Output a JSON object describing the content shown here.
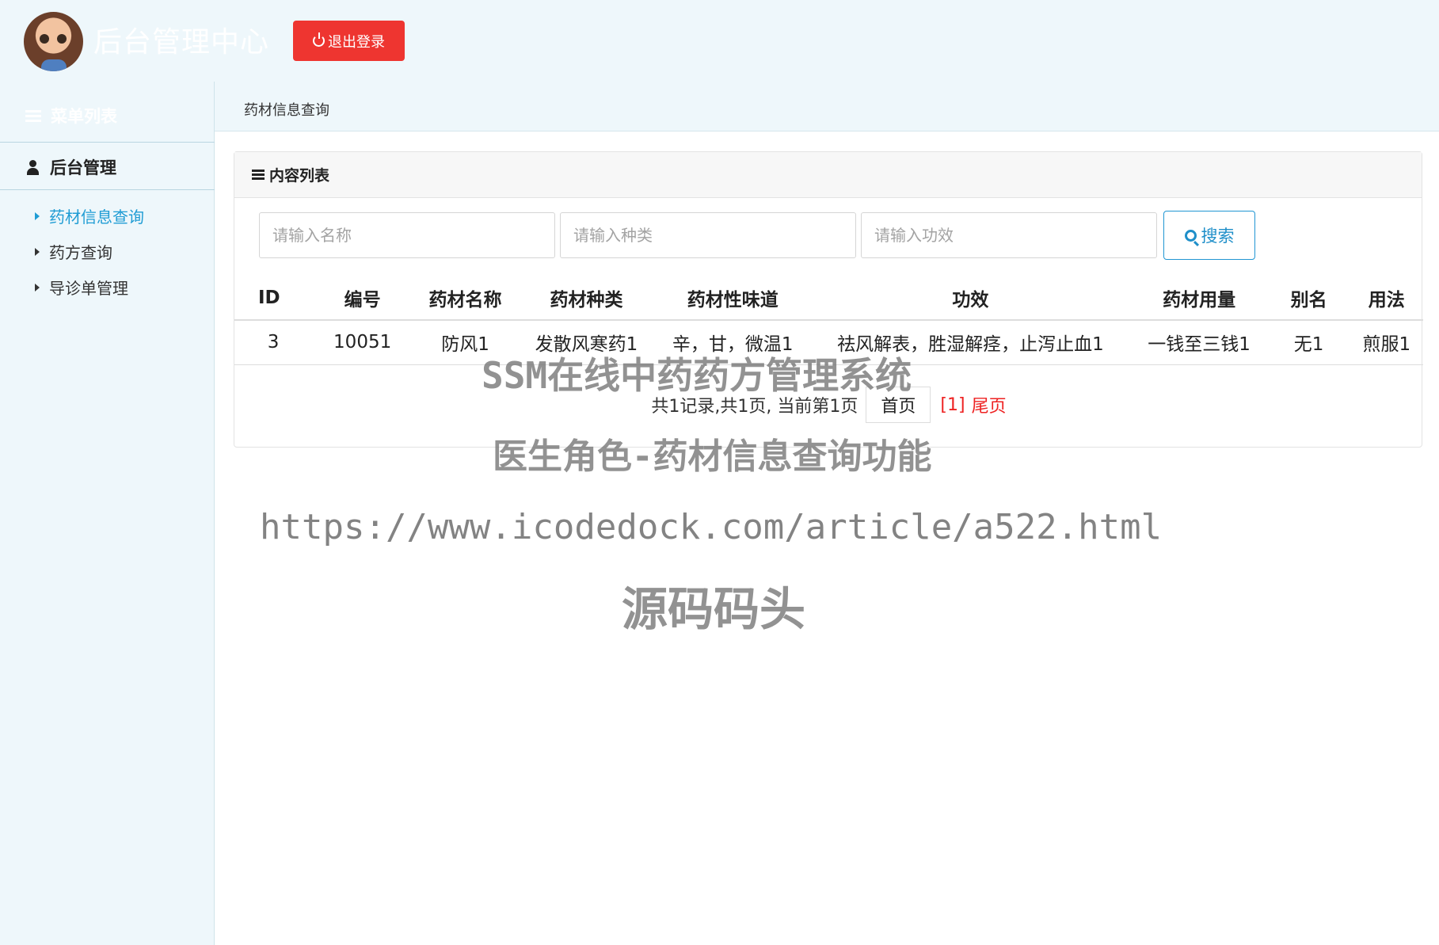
{
  "header": {
    "title": "后台管理中心",
    "logout_label": "退出登录"
  },
  "sidebar": {
    "menu_title": "菜单列表",
    "group_title": "后台管理",
    "items": [
      {
        "label": "药材信息查询",
        "active": true
      },
      {
        "label": "药方查询",
        "active": false
      },
      {
        "label": "导诊单管理",
        "active": false
      }
    ]
  },
  "main": {
    "breadcrumb": "药材信息查询",
    "panel_title": "内容列表",
    "search": {
      "name_placeholder": "请输入名称",
      "type_placeholder": "请输入种类",
      "effect_placeholder": "请输入功效",
      "button_label": "搜索"
    },
    "table": {
      "headers": [
        "ID",
        "编号",
        "药材名称",
        "药材种类",
        "药材性味道",
        "功效",
        "药材用量",
        "别名",
        "用法"
      ],
      "rows": [
        [
          "3",
          "10051",
          "防风1",
          "发散风寒药1",
          "辛，甘，微温1",
          "祛风解表，胜湿解痉，止泻止血1",
          "一钱至三钱1",
          "无1",
          "煎服1"
        ]
      ]
    },
    "pagination": {
      "summary": "共1记录,共1页, 当前第1页",
      "first_label": "首页",
      "current_label": "[1]",
      "last_label": "尾页"
    }
  },
  "watermark": {
    "line1": "SSM在线中药药方管理系统",
    "line2": "医生角色-药材信息查询功能",
    "line3": "https://www.icodedock.com/article/a522.html",
    "line4": "源码码头"
  },
  "colors": {
    "background": "#eef7fb",
    "logout": "#ee3530",
    "active": "#1f9cd4",
    "page_current": "#ee2222"
  }
}
